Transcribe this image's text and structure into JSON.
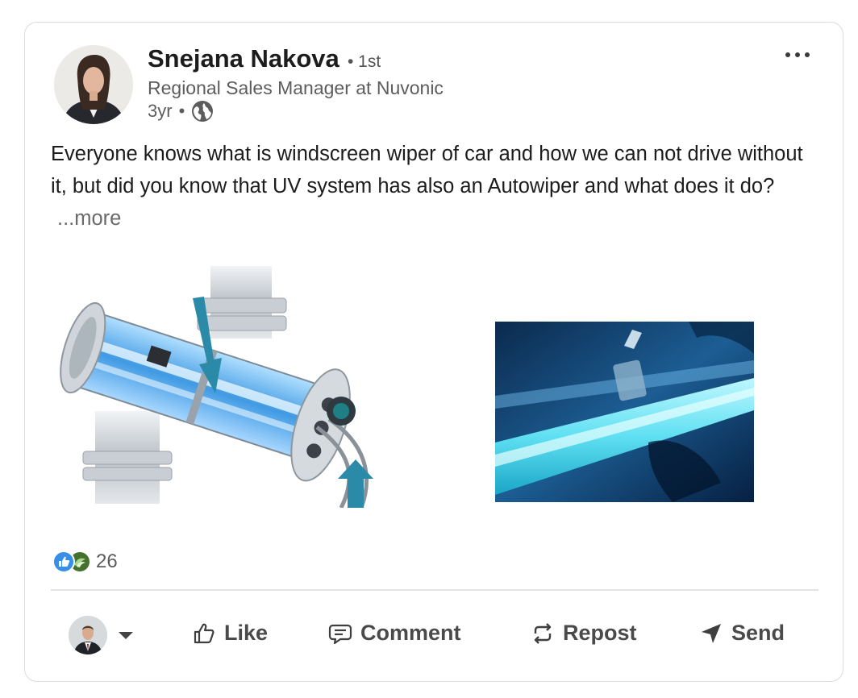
{
  "author": {
    "name": "Snejana Nakova",
    "degree": "• 1st",
    "headline": "Regional Sales Manager at Nuvonic",
    "time": "3yr",
    "time_separator": "•",
    "visibility_icon": "globe-icon"
  },
  "menu": {
    "icon": "more-horizontal-icon"
  },
  "post": {
    "text": "Everyone knows what is windscreen wiper of car and how we can not drive without it, but did you know that UV system has also an Autowiper and what does it do?",
    "see_more": "...more"
  },
  "media": [
    {
      "name": "uv-reactor-diagram-image"
    },
    {
      "name": "uv-lamp-photo-image"
    }
  ],
  "reactions": {
    "icons": [
      "like-reaction-icon",
      "support-reaction-icon"
    ],
    "count": "26"
  },
  "actions": {
    "actor_icon": "chevron-down-icon",
    "like": "Like",
    "comment": "Comment",
    "repost": "Repost",
    "send": "Send"
  },
  "colors": {
    "like_blue": "#378fe9",
    "support_green": "#44712e",
    "uv_blue": "#1d7fc9",
    "arrow_teal": "#2b8aa8"
  }
}
